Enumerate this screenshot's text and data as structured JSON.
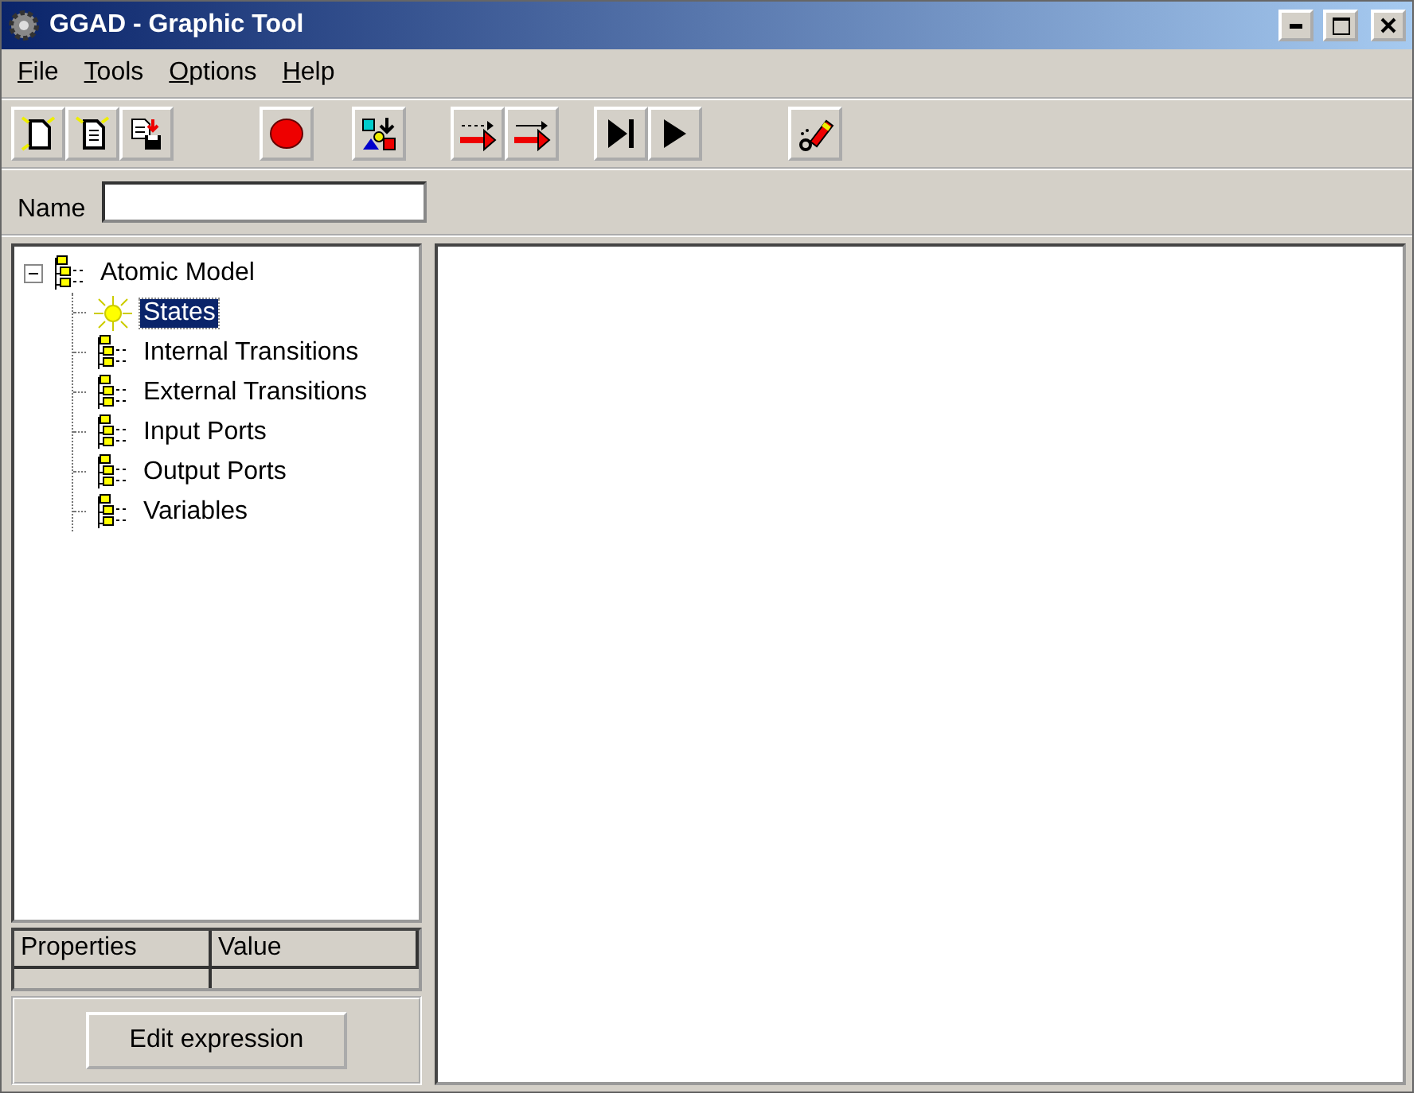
{
  "window": {
    "title": "GGAD - Graphic Tool"
  },
  "menu": [
    "File",
    "Tools",
    "Options",
    "Help"
  ],
  "name_field": {
    "label": "Name"
  },
  "tree": {
    "label": "Atomic Model",
    "expanded": true,
    "selected": false,
    "children": [
      {
        "label": "States",
        "kind": "sun",
        "selected": true
      },
      {
        "label": "Internal Transitions",
        "kind": "folder",
        "selected": false
      },
      {
        "label": "External Transitions",
        "kind": "folder",
        "selected": false
      },
      {
        "label": "Input Ports",
        "kind": "folder",
        "selected": false
      },
      {
        "label": "Output Ports",
        "kind": "folder",
        "selected": false
      },
      {
        "label": "Variables",
        "kind": "folder",
        "selected": false
      }
    ]
  },
  "properties": {
    "columns": [
      "Properties",
      "Value"
    ]
  },
  "buttons": [
    "Edit expression"
  ]
}
